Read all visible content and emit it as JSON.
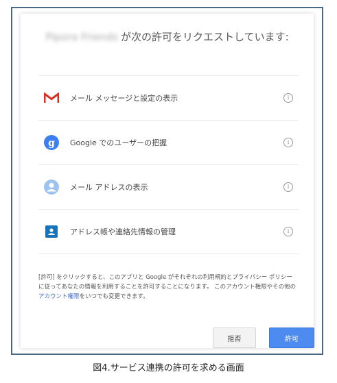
{
  "dialog": {
    "app_name": "Pipora Friends",
    "title_suffix": "が次の許可をリクエストしています:",
    "permissions": [
      {
        "icon": "gmail-icon",
        "label": "メール メッセージと設定の表示"
      },
      {
        "icon": "google-plus-icon",
        "label": "Google でのユーザーの把握"
      },
      {
        "icon": "person-icon",
        "label": "メール アドレスの表示"
      },
      {
        "icon": "contacts-icon",
        "label": "アドレス帳や連絡先情報の管理"
      }
    ],
    "info_glyph": "i",
    "disclaimer_part1": "[許可] をクリックすると、このアプリと Google がそれぞれの利用規約とプライバシー ポリシーに従ってあなたの情報を利用することを許可することになります。 このアカウント権限やその他の",
    "disclaimer_link": "アカウント権限",
    "disclaimer_part2": "をいつでも変更できます。",
    "deny_label": "拒否",
    "allow_label": "許可"
  },
  "caption": "図4.サービス連携の許可を求める画面",
  "colors": {
    "frame": "#4a6785",
    "allow_button": "#4d8bf0",
    "link": "#3f69c7",
    "gmail_red": "#d93025",
    "gplus_blue": "#3d7ef0",
    "contacts_blue": "#1a73b8"
  }
}
